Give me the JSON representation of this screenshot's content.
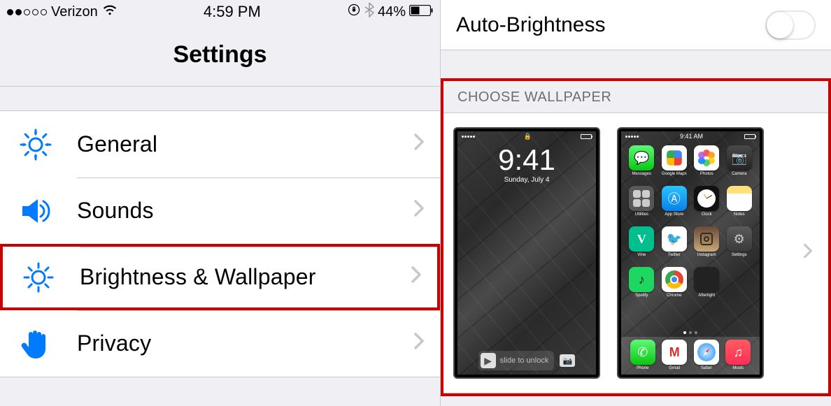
{
  "status_bar": {
    "carrier": "Verizon",
    "time": "4:59 PM",
    "battery_percent": "44%"
  },
  "header": {
    "title": "Settings"
  },
  "settings_rows": {
    "general": "General",
    "sounds": "Sounds",
    "brightness": "Brightness & Wallpaper",
    "privacy": "Privacy"
  },
  "right": {
    "auto_brightness_label": "Auto-Brightness",
    "auto_brightness_on": false,
    "choose_wallpaper_header": "CHOOSE WALLPAPER",
    "lock_screen": {
      "time": "9:41",
      "date": "Sunday, July 4",
      "slide_text": "slide to unlock"
    },
    "home_screen": {
      "time": "9:41 AM",
      "apps": [
        {
          "name": "Messages"
        },
        {
          "name": "Google Maps"
        },
        {
          "name": "Photos"
        },
        {
          "name": "Camera"
        },
        {
          "name": "Utilities"
        },
        {
          "name": "App Store"
        },
        {
          "name": "Clock"
        },
        {
          "name": "Notes"
        },
        {
          "name": "Vine"
        },
        {
          "name": "Twitter"
        },
        {
          "name": "Instagram"
        },
        {
          "name": "Settings"
        },
        {
          "name": "Spotify"
        },
        {
          "name": "Chrome"
        },
        {
          "name": "Afterlight"
        }
      ],
      "dock": [
        {
          "name": "Phone"
        },
        {
          "name": "Gmail"
        },
        {
          "name": "Safari"
        },
        {
          "name": "Music"
        }
      ]
    }
  }
}
